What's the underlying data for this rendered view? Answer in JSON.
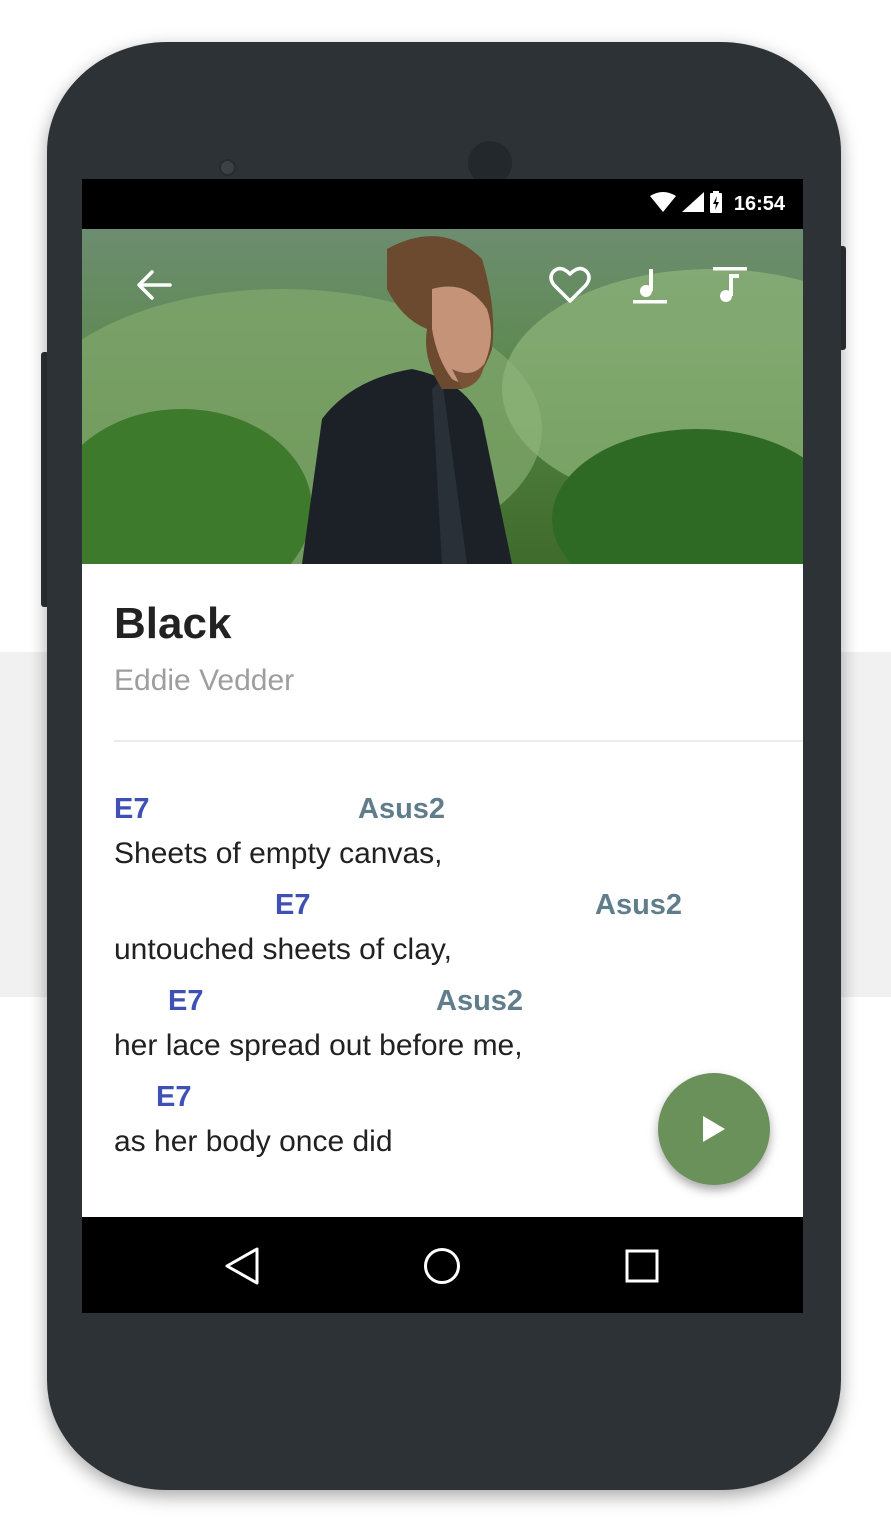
{
  "status_bar": {
    "time": "16:54",
    "icons": [
      "wifi-icon",
      "cell-signal-icon",
      "battery-icon"
    ]
  },
  "toolbar": {
    "icons": [
      "back-arrow-icon",
      "heart-icon",
      "music-note-icon",
      "note-list-icon"
    ]
  },
  "song": {
    "title": "Black",
    "artist": "Eddie Vedder"
  },
  "lyrics": [
    {
      "text": "Sheets of empty canvas,",
      "chords": [
        {
          "name": "E7"
        },
        {
          "name": "Asus2"
        }
      ]
    },
    {
      "text": "untouched sheets of clay,",
      "chords": [
        {
          "name": "E7"
        },
        {
          "name": "Asus2"
        }
      ]
    },
    {
      "text": "her lace spread out before me,",
      "chords": [
        {
          "name": "E7"
        },
        {
          "name": "Asus2"
        }
      ]
    },
    {
      "text": "as her body once did",
      "chords": [
        {
          "name": "E7"
        }
      ]
    }
  ],
  "fab": {
    "icon": "play-icon"
  },
  "nav_bar": {
    "icons": [
      "nav-back-icon",
      "nav-home-icon",
      "nav-recents-icon"
    ]
  },
  "colors": {
    "chord_primary": "#3f51b5",
    "chord_secondary": "#607d8b",
    "fab": "#6a9159",
    "phone_body": "#2c3236"
  }
}
